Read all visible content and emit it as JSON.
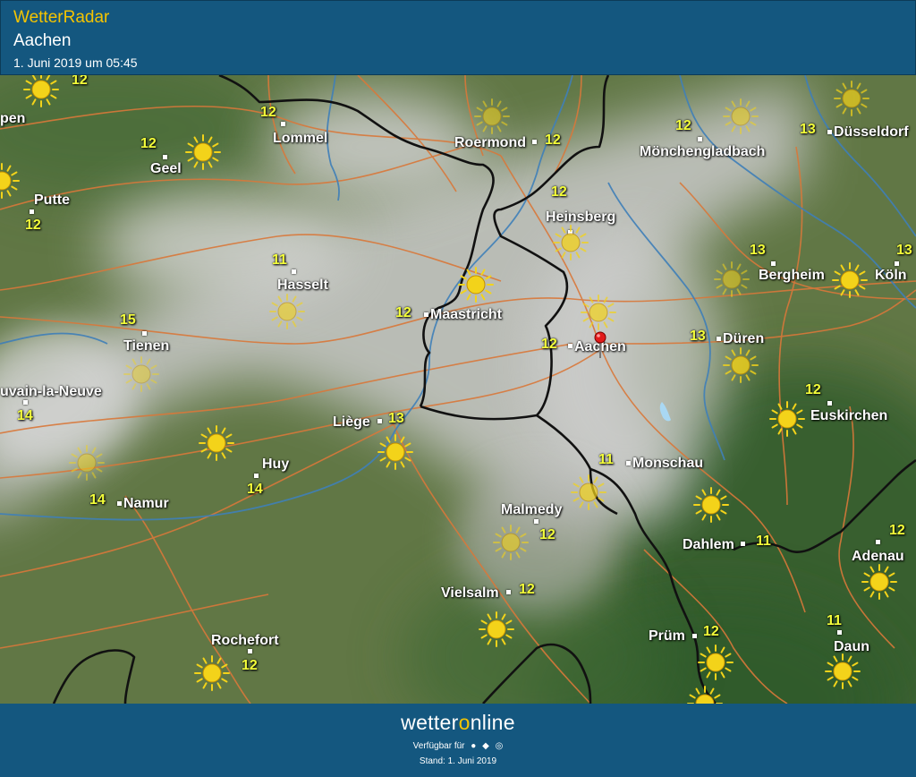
{
  "header": {
    "brand": "WetterRadar",
    "location": "Aachen",
    "datetime": "1. Juni 2019 um 05:45"
  },
  "map": {
    "towns": [
      {
        "id": "lommel",
        "name": "Lommel"
      },
      {
        "id": "geel",
        "name": "Geel"
      },
      {
        "id": "putte",
        "name": "Putte"
      },
      {
        "id": "roermond",
        "name": "Roermond"
      },
      {
        "id": "moenchengladbach",
        "name": "Mönchengladbach"
      },
      {
        "id": "duesseldorf",
        "name": "Düsseldorf"
      },
      {
        "id": "heinsberg",
        "name": "Heinsberg"
      },
      {
        "id": "bergheim",
        "name": "Bergheim"
      },
      {
        "id": "koeln",
        "name": "Köln"
      },
      {
        "id": "hasselt",
        "name": "Hasselt"
      },
      {
        "id": "maastricht",
        "name": "Maastricht"
      },
      {
        "id": "tienen",
        "name": "Tienen"
      },
      {
        "id": "aachen",
        "name": "Aachen"
      },
      {
        "id": "dueren",
        "name": "Düren"
      },
      {
        "id": "louvain",
        "name": "uvain-la-Neuve"
      },
      {
        "id": "euskirchen",
        "name": "Euskirchen"
      },
      {
        "id": "liege",
        "name": "Liège"
      },
      {
        "id": "huy",
        "name": "Huy"
      },
      {
        "id": "monschau",
        "name": "Monschau"
      },
      {
        "id": "namur",
        "name": "Namur"
      },
      {
        "id": "malmedy",
        "name": "Malmedy"
      },
      {
        "id": "dahlem",
        "name": "Dahlem"
      },
      {
        "id": "adenau",
        "name": "Adenau"
      },
      {
        "id": "vielsalm",
        "name": "Vielsalm"
      },
      {
        "id": "pruem",
        "name": "Prüm"
      },
      {
        "id": "rochefort",
        "name": "Rochefort"
      },
      {
        "id": "daun",
        "name": "Daun"
      },
      {
        "id": "edge_pen",
        "name": "pen"
      }
    ],
    "temps": [
      {
        "id": "t_top",
        "value": "12"
      },
      {
        "id": "t_lommel",
        "value": "12"
      },
      {
        "id": "t_geel",
        "value": "12"
      },
      {
        "id": "t_putte",
        "value": "12"
      },
      {
        "id": "t_roermond",
        "value": "12"
      },
      {
        "id": "t_mgl",
        "value": "12"
      },
      {
        "id": "t_dus",
        "value": "13"
      },
      {
        "id": "t_heinsberg",
        "value": "12"
      },
      {
        "id": "t_bergheim",
        "value": "13"
      },
      {
        "id": "t_koeln",
        "value": "13"
      },
      {
        "id": "t_hasselt",
        "value": "11"
      },
      {
        "id": "t_maastricht",
        "value": "12"
      },
      {
        "id": "t_tienen",
        "value": "15"
      },
      {
        "id": "t_aachen",
        "value": "12"
      },
      {
        "id": "t_dueren",
        "value": "13"
      },
      {
        "id": "t_louvain",
        "value": "14"
      },
      {
        "id": "t_euskirchen",
        "value": "12"
      },
      {
        "id": "t_liege",
        "value": "13"
      },
      {
        "id": "t_huy",
        "value": "14"
      },
      {
        "id": "t_monschau",
        "value": "11"
      },
      {
        "id": "t_namur",
        "value": "14"
      },
      {
        "id": "t_malmedy",
        "value": "12"
      },
      {
        "id": "t_dahlem",
        "value": "11"
      },
      {
        "id": "t_adenau",
        "value": "12"
      },
      {
        "id": "t_vielsalm",
        "value": "12"
      },
      {
        "id": "t_pruem",
        "value": "12"
      },
      {
        "id": "t_rochefort",
        "value": "12"
      },
      {
        "id": "t_daun",
        "value": "11"
      }
    ],
    "sun_icon": "sun-icon",
    "marker_icon": "location-pin-icon",
    "colors": {
      "road": "#d9783a",
      "river": "#3f7fb8",
      "border": "#111111",
      "temp": "#f4ff3a",
      "sun": "#f3d31a"
    }
  },
  "footer": {
    "logo_a": "wetter",
    "logo_o": "o",
    "logo_b": "nline",
    "available": "Verfügbar für",
    "platform_icons": [
      "android-icon",
      "apple-icon",
      "web-icon"
    ],
    "stand": "Stand: 1. Juni 2019"
  }
}
